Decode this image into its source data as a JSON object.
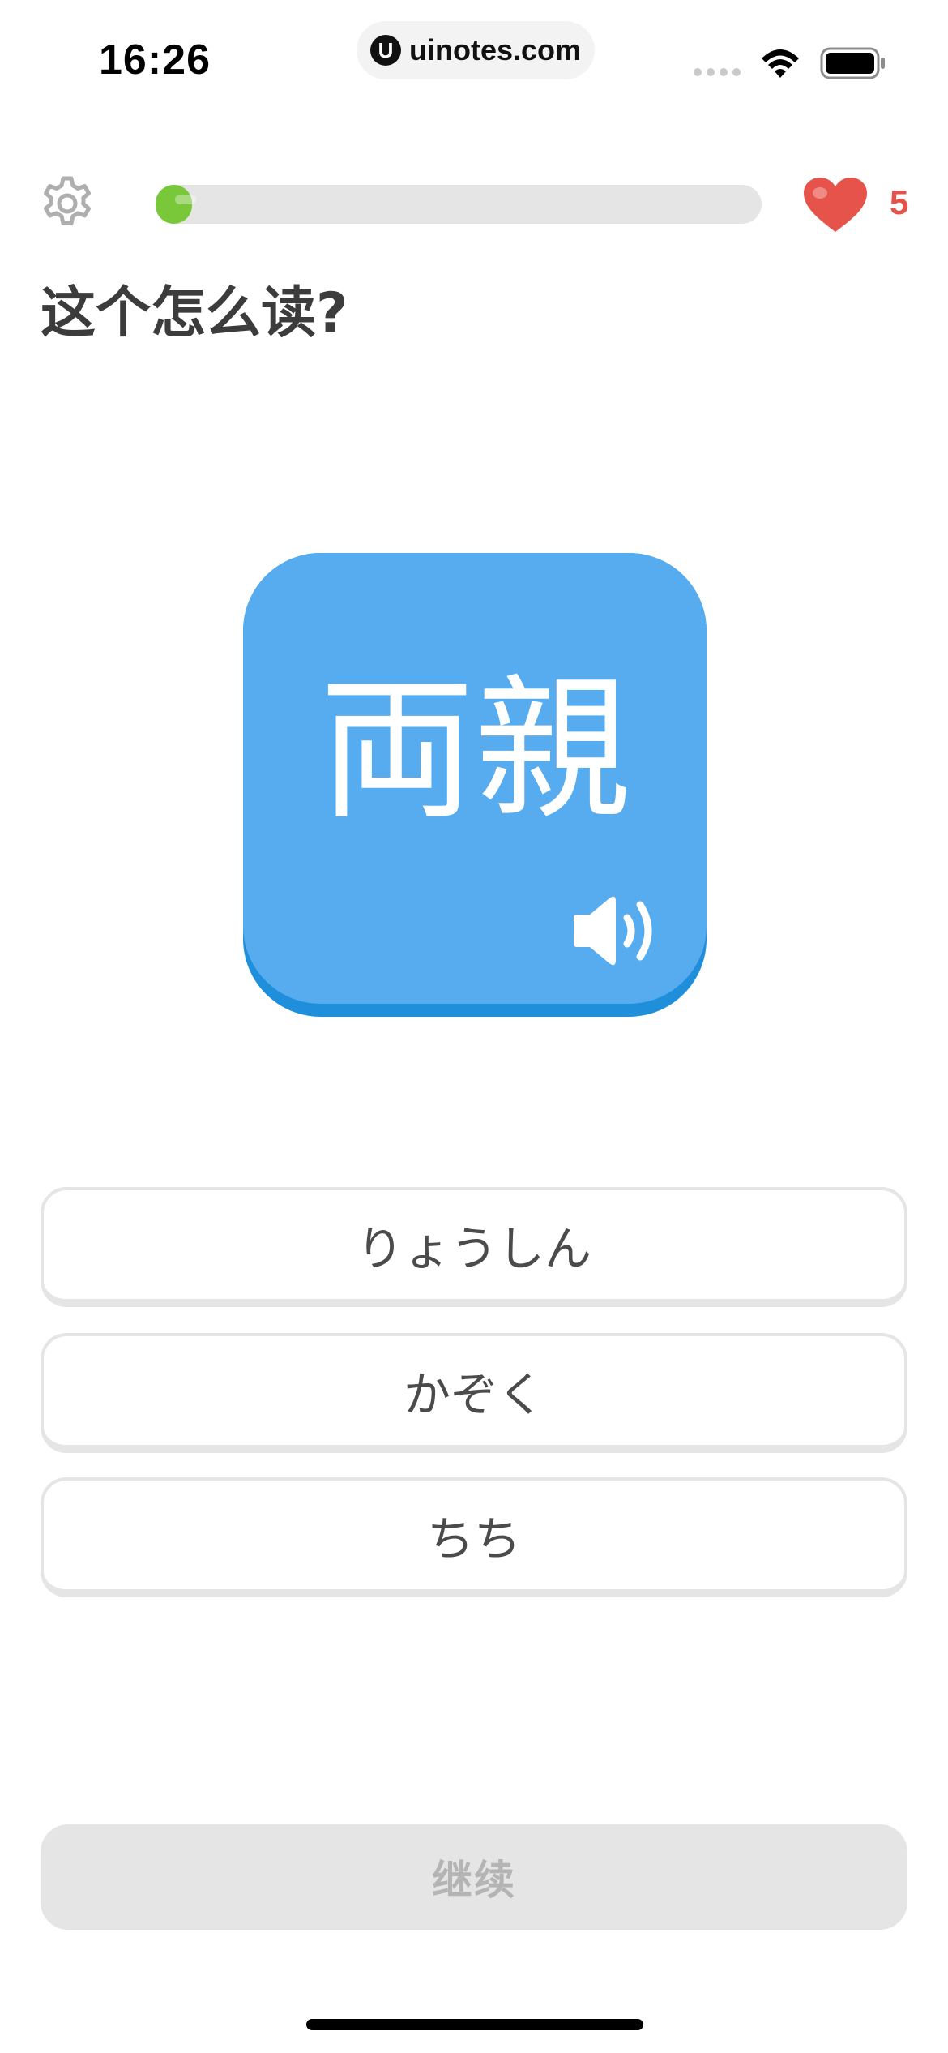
{
  "status_bar": {
    "time": "16:26",
    "url": "uinotes.com",
    "url_logo_glyph": "U",
    "icons": [
      "signal-dots-icon",
      "wifi-icon",
      "battery-icon"
    ]
  },
  "top_bar": {
    "settings_icon": "gear-icon",
    "progress_fraction": 0.06,
    "progress_color": "#78c83a",
    "hearts_icon": "heart-icon",
    "hearts_count": "5",
    "hearts_color": "#e5534b"
  },
  "question": {
    "prompt": "这个怎么读?",
    "word": "両親",
    "card_color": "#56acee",
    "audio_icon": "speaker-icon"
  },
  "options": [
    {
      "label": "りょうしん"
    },
    {
      "label": "かぞく"
    },
    {
      "label": "ちち"
    }
  ],
  "footer": {
    "continue_label": "继续",
    "continue_enabled": false
  }
}
